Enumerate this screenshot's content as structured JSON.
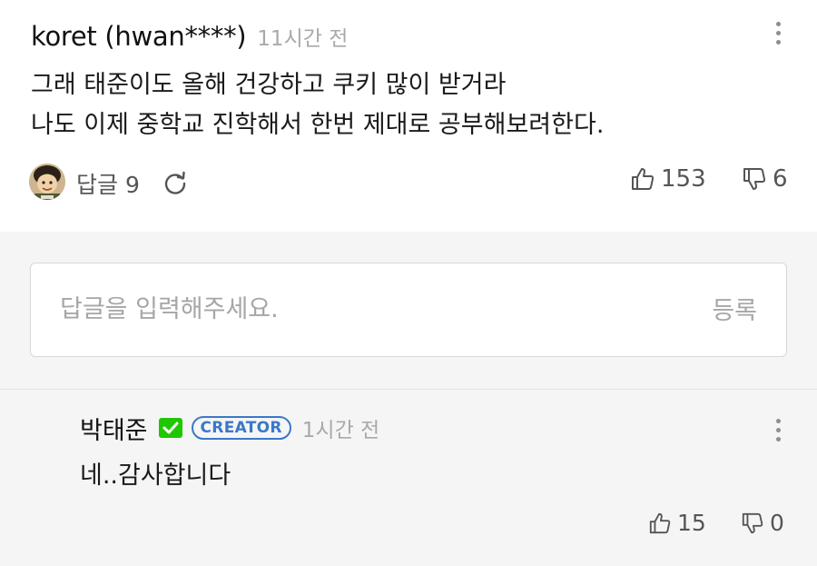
{
  "comment": {
    "author": "koret (hwan****)",
    "time": "11시간 전",
    "lines": [
      "그래 태준이도 올해 건강하고 쿠키 많이 받거라",
      "나도 이제 중학교 진학해서 한번 제대로 공부해보려한다."
    ],
    "reply_label": "답글",
    "reply_count": "9",
    "likes": "153",
    "dislikes": "6"
  },
  "reply_input": {
    "placeholder": "답글을 입력해주세요.",
    "submit_label": "등록"
  },
  "reply": {
    "author": "박태준",
    "badge": "CREATOR",
    "time": "1시간 전",
    "text": "네..감사합니다",
    "likes": "15",
    "dislikes": "0"
  },
  "colors": {
    "verified_green": "#1ec800",
    "creator_blue": "#3a78c9",
    "reply_area_bg": "#f5f5f5"
  },
  "icons": [
    "more-vertical-icon",
    "refresh-icon",
    "thumbs-up-icon",
    "thumbs-down-icon",
    "verified-check-icon"
  ]
}
